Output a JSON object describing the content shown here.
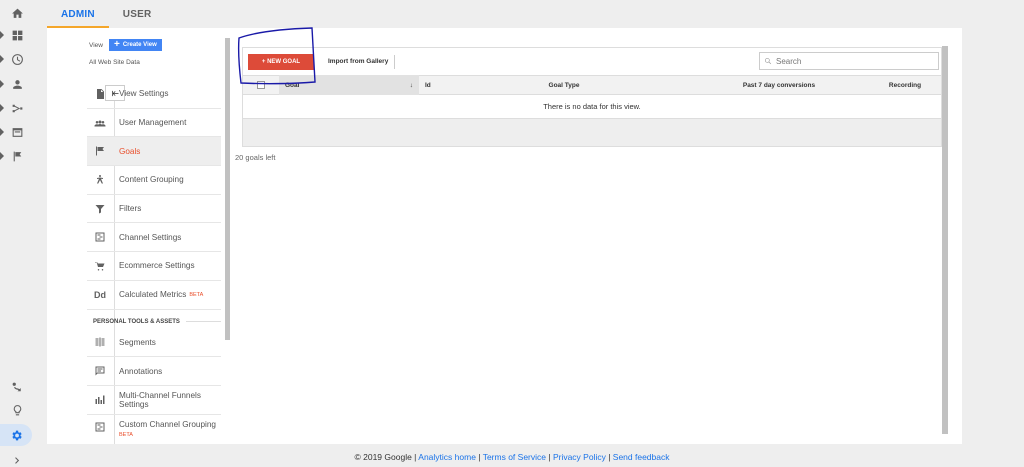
{
  "tabs": [
    "ADMIN",
    "USER"
  ],
  "view": {
    "label": "View",
    "create_label": "Create View",
    "name": "All Web Site Data"
  },
  "nav": {
    "items": [
      {
        "label": "View Settings",
        "icon": "document-icon"
      },
      {
        "label": "User Management",
        "icon": "people-icon"
      },
      {
        "label": "Goals",
        "icon": "flag-icon",
        "active": true
      },
      {
        "label": "Content Grouping",
        "icon": "person-walk-icon"
      },
      {
        "label": "Filters",
        "icon": "filter-icon"
      },
      {
        "label": "Channel Settings",
        "icon": "channel-icon"
      },
      {
        "label": "Ecommerce Settings",
        "icon": "cart-icon"
      },
      {
        "label": "Calculated Metrics",
        "beta": "BETA",
        "icon": "dd-icon"
      }
    ],
    "section": "PERSONAL TOOLS & ASSETS",
    "personal": [
      {
        "label": "Segments",
        "icon": "segments-icon"
      },
      {
        "label": "Annotations",
        "icon": "annotation-icon"
      },
      {
        "label_line1": "Multi-Channel Funnels",
        "label_line2": "Settings",
        "icon": "bar-chart-icon"
      },
      {
        "label": "Custom Channel Grouping",
        "beta": "BETA",
        "icon": "channel-icon"
      }
    ]
  },
  "toolbar": {
    "new_goal": "+ NEW GOAL",
    "import": "Import from Gallery",
    "search_placeholder": "Search"
  },
  "table": {
    "headers": {
      "goal": "Goal",
      "sort_arrow": "↓",
      "id": "Id",
      "goal_type": "Goal Type",
      "conversions": "Past 7 day conversions",
      "recording": "Recording"
    },
    "empty_message": "There is no data for this view."
  },
  "goals_left": "20 goals left",
  "footer": {
    "copyright": "© 2019 Google",
    "links": [
      "Analytics home",
      "Terms of Service",
      "Privacy Policy",
      "Send feedback"
    ]
  },
  "colors": {
    "accent_blue": "#1a73e8",
    "new_goal_red": "#dd4b39",
    "active_tab_underline": "#f4a62a",
    "annotation_ink": "#1a1aa8"
  }
}
